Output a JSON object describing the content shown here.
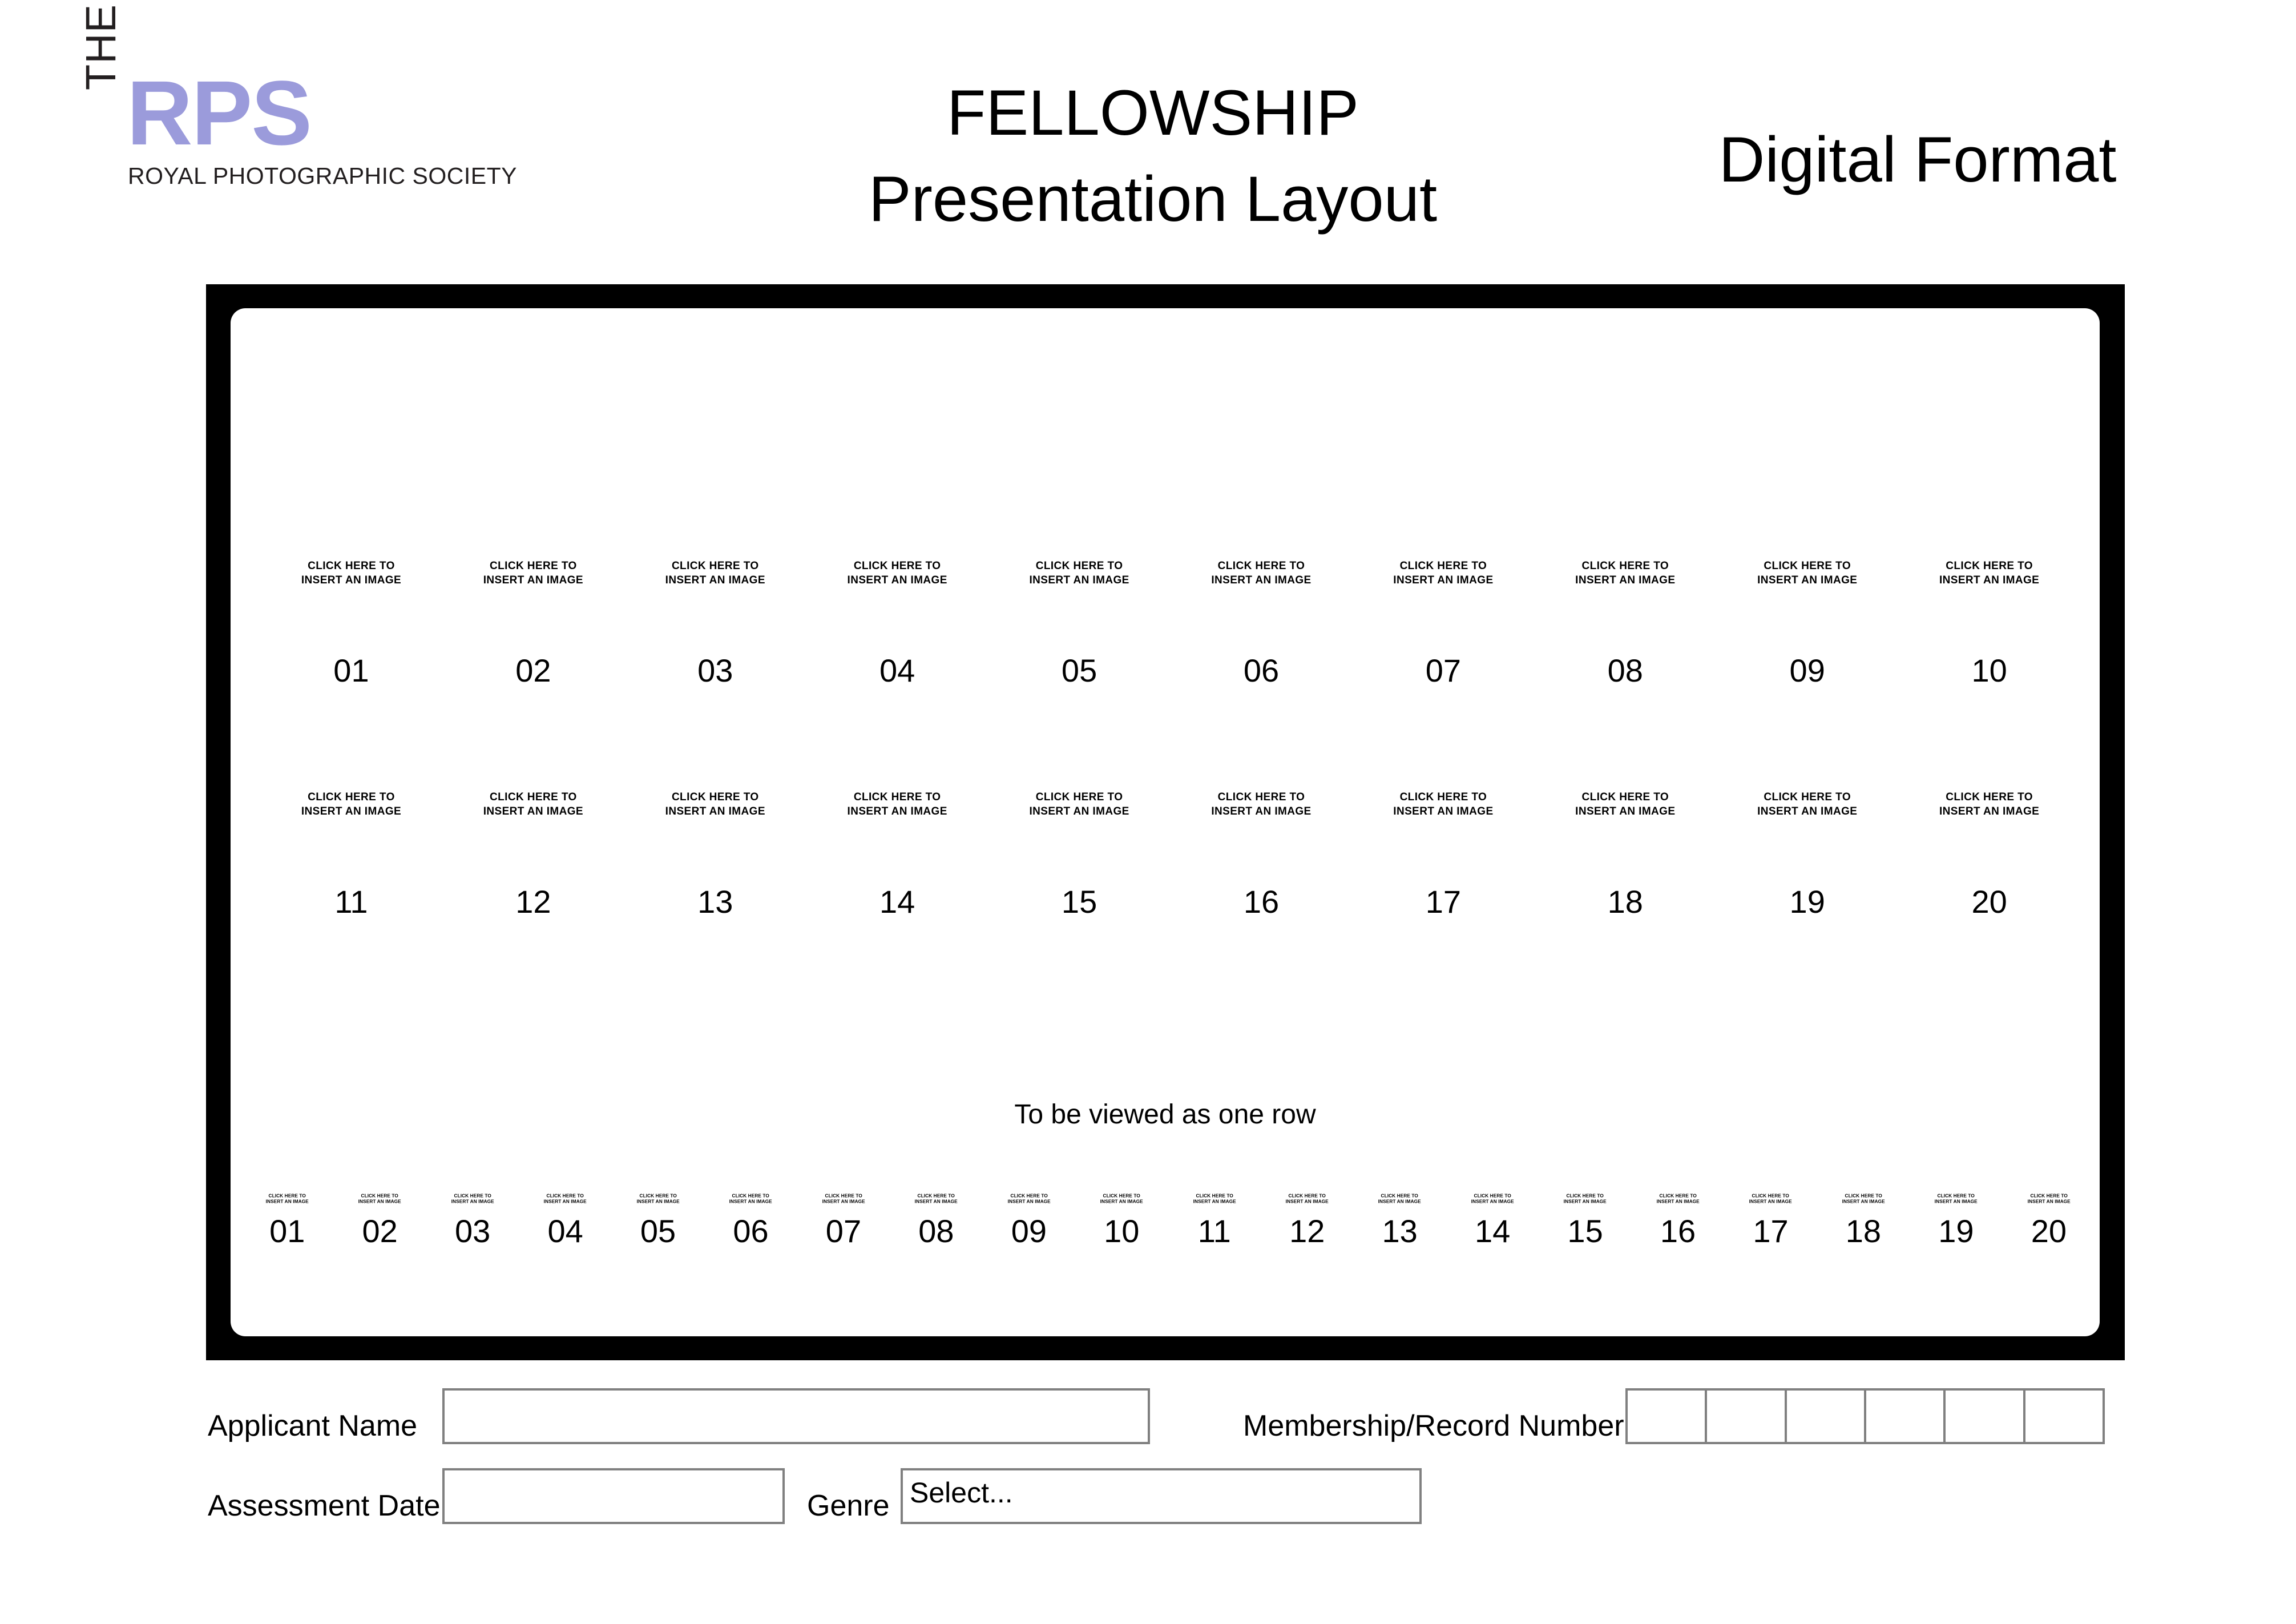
{
  "logo": {
    "the": "THE",
    "rps": "RPS",
    "society": "ROYAL\nPHOTOGRAPHIC\nSOCIETY",
    "purple_hex": "#9B9BDB",
    "black_hex": "#231F20"
  },
  "header": {
    "title_line1": "FELLOWSHIP",
    "title_line2": "Presentation Layout",
    "format_label": "Digital Format"
  },
  "panel": {
    "frame_color": "#000000",
    "stage_color": "#FFFFFF",
    "note": "To be viewed as one row",
    "placeholder_text": "CLICK HERE TO\nINSERT AN IMAGE",
    "row1": [
      {
        "placeholder": "CLICK HERE TO\nINSERT AN IMAGE",
        "number": "01"
      },
      {
        "placeholder": "CLICK HERE TO\nINSERT AN IMAGE",
        "number": "02"
      },
      {
        "placeholder": "CLICK HERE TO\nINSERT AN IMAGE",
        "number": "03"
      },
      {
        "placeholder": "CLICK HERE TO\nINSERT AN IMAGE",
        "number": "04"
      },
      {
        "placeholder": "CLICK HERE TO\nINSERT AN IMAGE",
        "number": "05"
      },
      {
        "placeholder": "CLICK HERE TO\nINSERT AN IMAGE",
        "number": "06"
      },
      {
        "placeholder": "CLICK HERE TO\nINSERT AN IMAGE",
        "number": "07"
      },
      {
        "placeholder": "CLICK HERE TO\nINSERT AN IMAGE",
        "number": "08"
      },
      {
        "placeholder": "CLICK HERE TO\nINSERT AN IMAGE",
        "number": "09"
      },
      {
        "placeholder": "CLICK HERE TO\nINSERT AN IMAGE",
        "number": "10"
      }
    ],
    "row2": [
      {
        "placeholder": "CLICK HERE TO\nINSERT AN IMAGE",
        "number": "11"
      },
      {
        "placeholder": "CLICK HERE TO\nINSERT AN IMAGE",
        "number": "12"
      },
      {
        "placeholder": "CLICK HERE TO\nINSERT AN IMAGE",
        "number": "13"
      },
      {
        "placeholder": "CLICK HERE TO\nINSERT AN IMAGE",
        "number": "14"
      },
      {
        "placeholder": "CLICK HERE TO\nINSERT AN IMAGE",
        "number": "15"
      },
      {
        "placeholder": "CLICK HERE TO\nINSERT AN IMAGE",
        "number": "16"
      },
      {
        "placeholder": "CLICK HERE TO\nINSERT AN IMAGE",
        "number": "17"
      },
      {
        "placeholder": "CLICK HERE TO\nINSERT AN IMAGE",
        "number": "18"
      },
      {
        "placeholder": "CLICK HERE TO\nINSERT AN IMAGE",
        "number": "19"
      },
      {
        "placeholder": "CLICK HERE TO\nINSERT AN IMAGE",
        "number": "20"
      }
    ],
    "strip": [
      {
        "placeholder": "CLICK HERE TO\nINSERT AN IMAGE",
        "number": "01"
      },
      {
        "placeholder": "CLICK HERE TO\nINSERT AN IMAGE",
        "number": "02"
      },
      {
        "placeholder": "CLICK HERE TO\nINSERT AN IMAGE",
        "number": "03"
      },
      {
        "placeholder": "CLICK HERE TO\nINSERT AN IMAGE",
        "number": "04"
      },
      {
        "placeholder": "CLICK HERE TO\nINSERT AN IMAGE",
        "number": "05"
      },
      {
        "placeholder": "CLICK HERE TO\nINSERT AN IMAGE",
        "number": "06"
      },
      {
        "placeholder": "CLICK HERE TO\nINSERT AN IMAGE",
        "number": "07"
      },
      {
        "placeholder": "CLICK HERE TO\nINSERT AN IMAGE",
        "number": "08"
      },
      {
        "placeholder": "CLICK HERE TO\nINSERT AN IMAGE",
        "number": "09"
      },
      {
        "placeholder": "CLICK HERE TO\nINSERT AN IMAGE",
        "number": "10"
      },
      {
        "placeholder": "CLICK HERE TO\nINSERT AN IMAGE",
        "number": "11"
      },
      {
        "placeholder": "CLICK HERE TO\nINSERT AN IMAGE",
        "number": "12"
      },
      {
        "placeholder": "CLICK HERE TO\nINSERT AN IMAGE",
        "number": "13"
      },
      {
        "placeholder": "CLICK HERE TO\nINSERT AN IMAGE",
        "number": "14"
      },
      {
        "placeholder": "CLICK HERE TO\nINSERT AN IMAGE",
        "number": "15"
      },
      {
        "placeholder": "CLICK HERE TO\nINSERT AN IMAGE",
        "number": "16"
      },
      {
        "placeholder": "CLICK HERE TO\nINSERT AN IMAGE",
        "number": "17"
      },
      {
        "placeholder": "CLICK HERE TO\nINSERT AN IMAGE",
        "number": "18"
      },
      {
        "placeholder": "CLICK HERE TO\nINSERT AN IMAGE",
        "number": "19"
      },
      {
        "placeholder": "CLICK HERE TO\nINSERT AN IMAGE",
        "number": "20"
      }
    ]
  },
  "form": {
    "applicant_label": "Applicant Name",
    "applicant_value": "",
    "membership_label": "Membership/Record Number",
    "membership_cells": [
      "",
      "",
      "",
      "",
      "",
      ""
    ],
    "assessment_label": "Assessment Date",
    "assessment_value": "",
    "genre_label": "Genre",
    "genre_value": "Select...",
    "field_border_hex": "#808080"
  }
}
